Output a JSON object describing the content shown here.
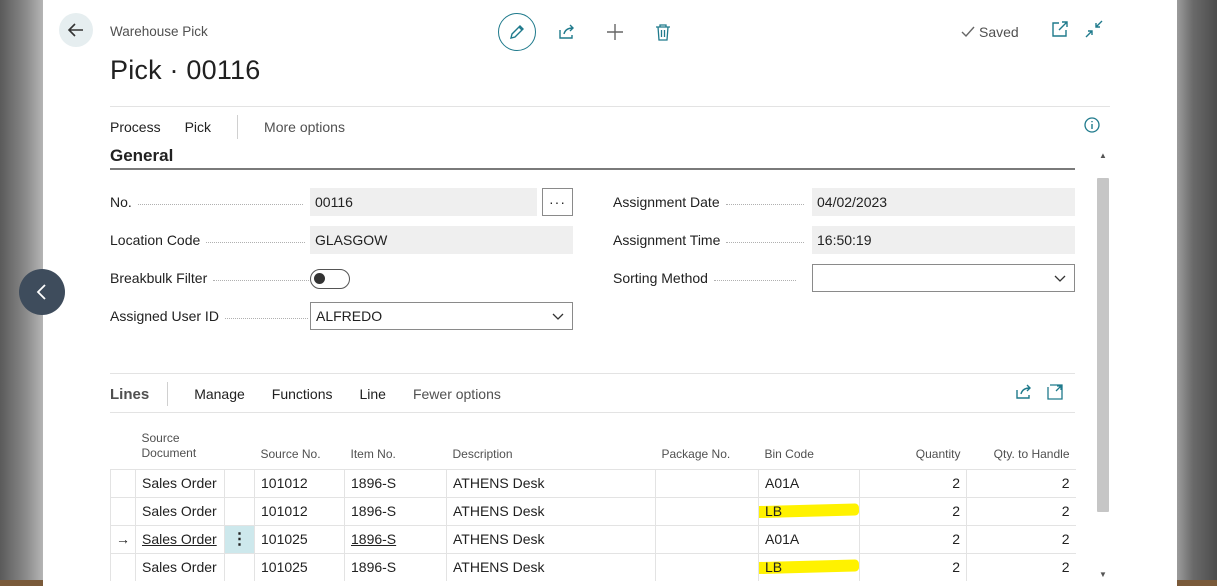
{
  "header": {
    "breadcrumb": "Warehouse Pick",
    "title": "Pick · 00116",
    "saved_label": "Saved"
  },
  "actions": {
    "process": "Process",
    "pick": "Pick",
    "more": "More options"
  },
  "general": {
    "title": "General",
    "no_label": "No.",
    "no_value": "00116",
    "lookup_glyph": "···",
    "location_label": "Location Code",
    "location_value": "GLASGOW",
    "breakbulk_label": "Breakbulk Filter",
    "breakbulk_on": false,
    "user_label": "Assigned User ID",
    "user_value": "ALFREDO",
    "date_label": "Assignment Date",
    "date_value": "04/02/2023",
    "time_label": "Assignment Time",
    "time_value": "16:50:19",
    "sorting_label": "Sorting Method",
    "sorting_value": ""
  },
  "lines": {
    "title": "Lines",
    "manage": "Manage",
    "functions": "Functions",
    "line": "Line",
    "fewer": "Fewer options",
    "columns": {
      "source_document_1": "Source",
      "source_document_2": "Document",
      "source_no": "Source No.",
      "item_no": "Item No.",
      "description": "Description",
      "package_no": "Package No.",
      "bin_code": "Bin Code",
      "quantity": "Quantity",
      "qty_to_handle": "Qty. to Handle"
    },
    "rows": [
      {
        "source_document": "Sales Order",
        "source_no": "101012",
        "item_no": "1896-S",
        "description": "ATHENS Desk",
        "package_no": "",
        "bin_code": "A01A",
        "quantity": "2",
        "qty_to_handle": "2"
      },
      {
        "source_document": "Sales Order",
        "source_no": "101012",
        "item_no": "1896-S",
        "description": "ATHENS Desk",
        "package_no": "",
        "bin_code": "LB",
        "quantity": "2",
        "qty_to_handle": "2"
      },
      {
        "source_document": "Sales Order",
        "source_no": "101025",
        "item_no": "1896-S",
        "description": "ATHENS Desk",
        "package_no": "",
        "bin_code": "A01A",
        "quantity": "2",
        "qty_to_handle": "2"
      },
      {
        "source_document": "Sales Order",
        "source_no": "101025",
        "item_no": "1896-S",
        "description": "ATHENS Desk",
        "package_no": "",
        "bin_code": "LB",
        "quantity": "2",
        "qty_to_handle": "2"
      }
    ],
    "selected_row_marker": "→",
    "row_menu_glyph": "⋮"
  },
  "colors": {
    "accent": "#1f7a8c",
    "highlight": "#fff200",
    "selected_cell": "#cde8ec"
  },
  "icons": [
    "back-arrow-icon",
    "edit-pencil-icon",
    "share-icon",
    "plus-icon",
    "delete-icon",
    "check-icon",
    "open-new-window-icon",
    "collapse-icon",
    "info-icon",
    "chevron-down-icon",
    "prev-chevron-icon",
    "expand-icon"
  ]
}
